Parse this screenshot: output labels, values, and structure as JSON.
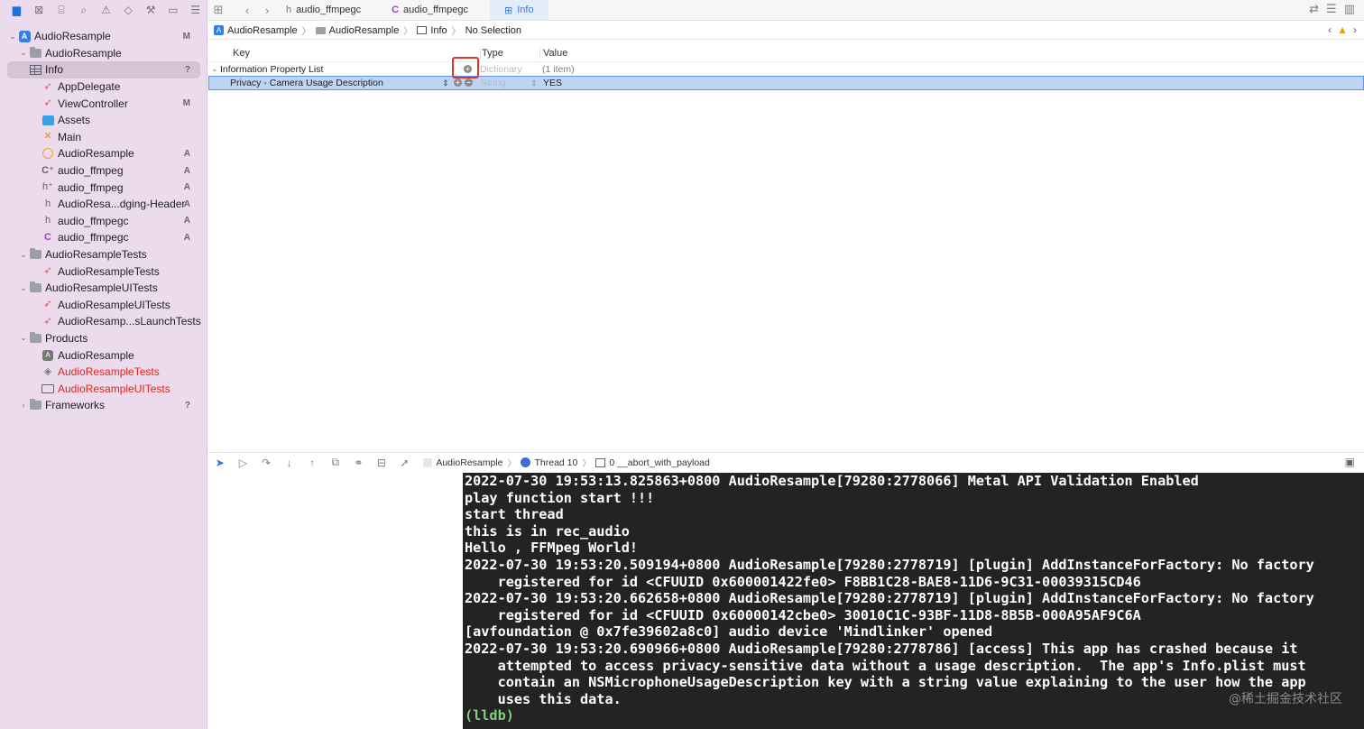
{
  "sidebar": {
    "toolbar_icons": [
      "folder-icon",
      "source-control-icon",
      "hierarchy-icon",
      "find-icon",
      "issue-icon",
      "test-icon",
      "debug-icon",
      "breakpoint-icon",
      "report-icon"
    ],
    "items": [
      {
        "label": "AudioResample",
        "status": "M",
        "icon": "project-icon",
        "level": 0,
        "expanded": true
      },
      {
        "label": "AudioResample",
        "status": "",
        "icon": "folder-icon",
        "level": 1,
        "expanded": true
      },
      {
        "label": "Info",
        "status": "?",
        "icon": "plist-icon",
        "level": 2,
        "selected": true
      },
      {
        "label": "AppDelegate",
        "status": "",
        "icon": "swift-icon",
        "level": 2
      },
      {
        "label": "ViewController",
        "status": "M",
        "icon": "swift-icon",
        "level": 2
      },
      {
        "label": "Assets",
        "status": "",
        "icon": "assets-icon",
        "level": 2
      },
      {
        "label": "Main",
        "status": "",
        "icon": "storyboard-icon",
        "level": 2
      },
      {
        "label": "AudioResample",
        "status": "A",
        "icon": "entitlements-icon",
        "level": 2
      },
      {
        "label": "audio_ffmpeg",
        "status": "A",
        "icon": "cpp-file-icon",
        "level": 2
      },
      {
        "label": "audio_ffmpeg",
        "status": "A",
        "icon": "cpp-header-icon",
        "level": 2
      },
      {
        "label": "AudioResa...dging-Header",
        "status": "A",
        "icon": "header-icon",
        "level": 2
      },
      {
        "label": "audio_ffmpegc",
        "status": "A",
        "icon": "header-icon",
        "level": 2
      },
      {
        "label": "audio_ffmpegc",
        "status": "A",
        "icon": "c-file-icon",
        "level": 2
      },
      {
        "label": "AudioResampleTests",
        "status": "",
        "icon": "folder-icon",
        "level": 1,
        "expanded": true
      },
      {
        "label": "AudioResampleTests",
        "status": "",
        "icon": "swift-icon",
        "level": 2
      },
      {
        "label": "AudioResampleUITests",
        "status": "",
        "icon": "folder-icon",
        "level": 1,
        "expanded": true
      },
      {
        "label": "AudioResampleUITests",
        "status": "",
        "icon": "swift-icon",
        "level": 2
      },
      {
        "label": "AudioResamp...sLaunchTests",
        "status": "",
        "icon": "swift-icon",
        "level": 2
      },
      {
        "label": "Products",
        "status": "",
        "icon": "folder-icon",
        "level": 1,
        "expanded": true
      },
      {
        "label": "AudioResample",
        "status": "",
        "icon": "app-icon",
        "level": 2
      },
      {
        "label": "AudioResampleTests",
        "status": "",
        "icon": "xctest-icon",
        "level": 2,
        "missing": true
      },
      {
        "label": "AudioResampleUITests",
        "status": "",
        "icon": "xcuitest-icon",
        "level": 2,
        "missing": true
      },
      {
        "label": "Frameworks",
        "status": "?",
        "icon": "folder-icon",
        "level": 1,
        "expanded": false
      }
    ]
  },
  "tabs": [
    {
      "label": "audio_ffmpegc",
      "icon": "header-icon"
    },
    {
      "label": "audio_ffmpegc",
      "icon": "c-file-icon"
    },
    {
      "label": "Info",
      "icon": "plist-icon",
      "active": true
    }
  ],
  "jumpbar": {
    "crumbs": [
      "AudioResample",
      "AudioResample",
      "Info",
      "No Selection"
    ]
  },
  "plist": {
    "headers": {
      "key": "Key",
      "type": "Type",
      "value": "Value"
    },
    "rows": [
      {
        "key": "Information Property List",
        "type": "Dictionary",
        "value": "(1 item)"
      },
      {
        "key": "Privacy - Camera Usage Description",
        "type": "String",
        "value": "YES"
      }
    ]
  },
  "debug": {
    "crumbs": {
      "process": "AudioResample",
      "thread": "Thread 10",
      "frame": "0 __abort_with_payload"
    }
  },
  "console": {
    "lines": [
      "2022-07-30 19:53:13.825863+0800 AudioResample[79280:2778066] Metal API Validation Enabled",
      "play function start !!!",
      "start thread",
      "this is in rec_audio",
      "Hello , FFMpeg World!",
      "2022-07-30 19:53:20.509194+0800 AudioResample[79280:2778719] [plugin] AddInstanceForFactory: No factory",
      "    registered for id <CFUUID 0x600001422fe0> F8BB1C28-BAE8-11D6-9C31-00039315CD46",
      "2022-07-30 19:53:20.662658+0800 AudioResample[79280:2778719] [plugin] AddInstanceForFactory: No factory",
      "    registered for id <CFUUID 0x60000142cbe0> 30010C1C-93BF-11D8-8B5B-000A95AF9C6A",
      "[avfoundation @ 0x7fe39602a8c0] audio device 'Mindlinker' opened",
      "2022-07-30 19:53:20.690966+0800 AudioResample[79280:2778786] [access] This app has crashed because it",
      "    attempted to access privacy-sensitive data without a usage description.  The app's Info.plist must",
      "    contain an NSMicrophoneUsageDescription key with a string value explaining to the user how the app",
      "    uses this data."
    ],
    "prompt": "(lldb)",
    "watermark": "@稀土掘金技术社区"
  }
}
